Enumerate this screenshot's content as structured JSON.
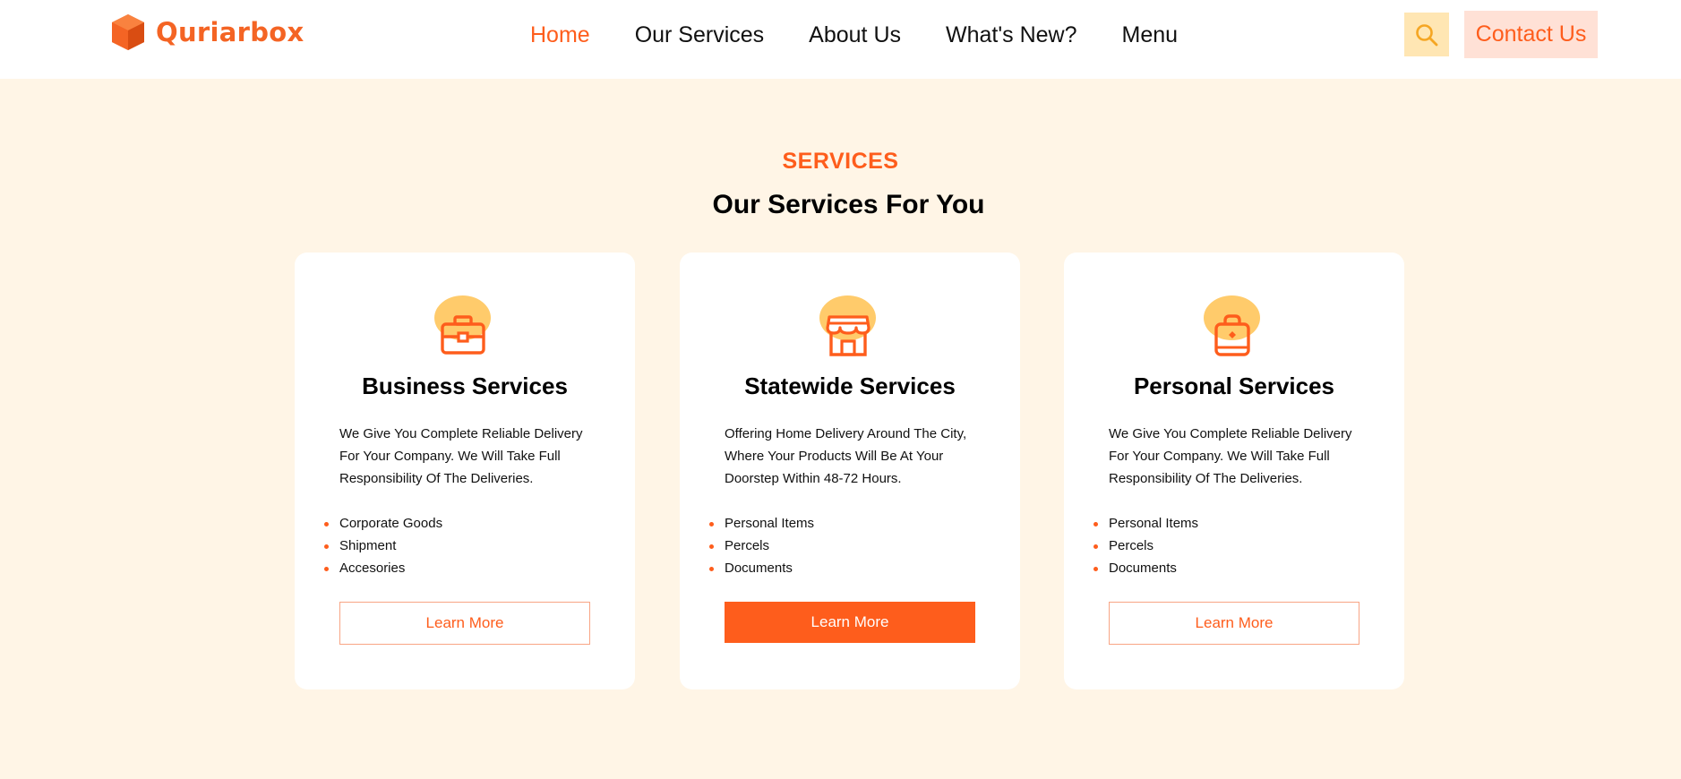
{
  "brand": {
    "name": "Quriarbox",
    "color": "#f46424"
  },
  "nav": {
    "items": [
      {
        "label": "Home",
        "active": true
      },
      {
        "label": "Our Services",
        "active": false
      },
      {
        "label": "About Us",
        "active": false
      },
      {
        "label": "What's New?",
        "active": false
      },
      {
        "label": "Menu",
        "active": false
      }
    ]
  },
  "header": {
    "search_icon": "search-icon",
    "contact_label": "Contact Us"
  },
  "section": {
    "eyebrow": "SERVICES",
    "title": "Our Services For You"
  },
  "cards": [
    {
      "icon": "briefcase-icon",
      "title": "Business Services",
      "description": "We Give You Complete Reliable Delivery For Your Company. We Will Take Full Responsibility Of The Deliveries.",
      "items": [
        "Corporate Goods",
        "Shipment",
        "Accesories"
      ],
      "button": "Learn More",
      "button_style": "outline"
    },
    {
      "icon": "storefront-icon",
      "title": "Statewide Services",
      "description": "Offering Home Delivery Around The City, Where Your Products Will Be At Your Doorstep Within 48-72 Hours.",
      "items": [
        "Personal Items",
        "Percels",
        "Documents"
      ],
      "button": "Learn More",
      "button_style": "filled"
    },
    {
      "icon": "bag-icon",
      "title": "Personal Services",
      "description": "We Give You Complete Reliable Delivery For Your Company. We Will Take Full Responsibility Of The Deliveries.",
      "items": [
        "Personal Items",
        "Percels",
        "Documents"
      ],
      "button": "Learn More",
      "button_style": "outline"
    }
  ],
  "colors": {
    "accent": "#fe5d1c",
    "page_background": "#fff5e6",
    "icon_blob": "#ffcb6b",
    "search_button": "#ffe6b3",
    "contact_button": "#ffe1d6"
  }
}
